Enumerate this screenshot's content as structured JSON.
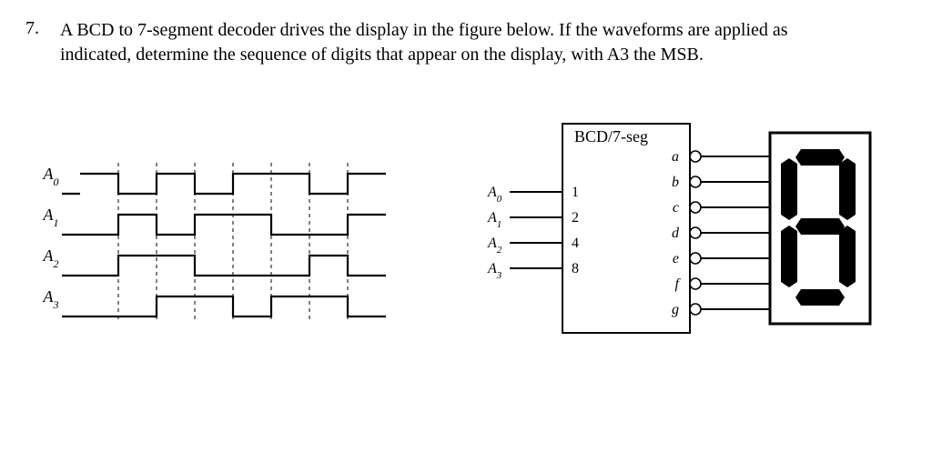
{
  "question": {
    "number": "7.",
    "text": "A BCD to 7-segment decoder drives the display in the figure below. If the waveforms are applied as indicated, determine the sequence of digits that appear on the display, with A3 the MSB."
  },
  "waveforms": {
    "signals": [
      "A0",
      "A1",
      "A2",
      "A3"
    ],
    "columns": 8,
    "data": {
      "A0": [
        1,
        0,
        1,
        0,
        1,
        1,
        0,
        1
      ],
      "A1": [
        0,
        1,
        0,
        1,
        1,
        0,
        0,
        1
      ],
      "A2": [
        0,
        1,
        1,
        0,
        0,
        0,
        1,
        0
      ],
      "A3": [
        0,
        0,
        1,
        1,
        0,
        1,
        1,
        0
      ]
    }
  },
  "decoder": {
    "label": "BCD/7-seg",
    "inputs": [
      {
        "pin": "A0",
        "weight": "1"
      },
      {
        "pin": "A1",
        "weight": "2"
      },
      {
        "pin": "A2",
        "weight": "4"
      },
      {
        "pin": "A3",
        "weight": "8"
      }
    ],
    "outputs": [
      "a",
      "b",
      "c",
      "d",
      "e",
      "f",
      "g"
    ]
  },
  "display": {
    "digit_shown": "8"
  }
}
